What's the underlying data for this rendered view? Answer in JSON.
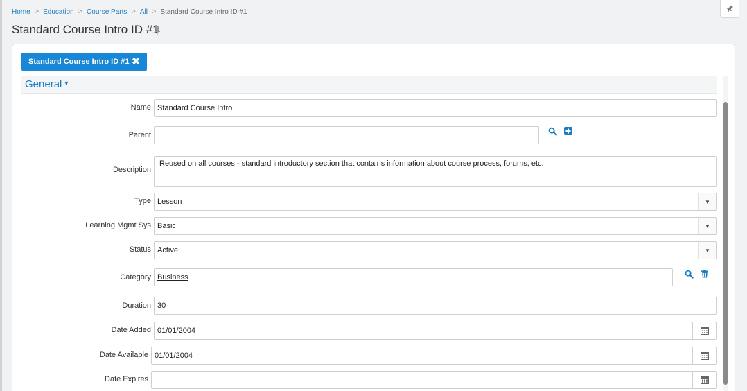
{
  "breadcrumb": {
    "items": [
      "Home",
      "Education",
      "Course Parts",
      "All"
    ],
    "separator": ">",
    "current": "Standard Course Intro ID #1"
  },
  "page_title": "Standard Course Intro ID #1",
  "record_tab": {
    "label": "Standard Course Intro ID #1",
    "close_glyph": "✖"
  },
  "section": {
    "title": "General",
    "caret": "▼"
  },
  "form": {
    "name": {
      "label": "Name",
      "value": "Standard Course Intro"
    },
    "parent": {
      "label": "Parent",
      "value": ""
    },
    "description": {
      "label": "Description",
      "value": "Reused on all courses - standard introductory section that contains information about course process, forums, etc."
    },
    "type": {
      "label": "Type",
      "value": "Lesson"
    },
    "learning_mgmt": {
      "label": "Learning Mgmt Sys",
      "value": "Basic"
    },
    "status": {
      "label": "Status",
      "value": "Active"
    },
    "category": {
      "label": "Category",
      "value": "Business"
    },
    "duration": {
      "label": "Duration",
      "value": "30"
    },
    "date_added": {
      "label": "Date Added",
      "value": "01/01/2004"
    },
    "date_available": {
      "label": "Date Available",
      "value": "01/01/2004"
    },
    "date_expires": {
      "label": "Date Expires",
      "value": ""
    }
  },
  "dropdown_glyph": "▼",
  "colors": {
    "accent": "#1888d6",
    "link": "#1a7dc4",
    "background": "#f1f2f4"
  },
  "icons": [
    "pin-icon",
    "search-icon",
    "add-icon",
    "trash-icon",
    "calendar-icon",
    "close-icon",
    "dropdown-arrow-icon"
  ]
}
